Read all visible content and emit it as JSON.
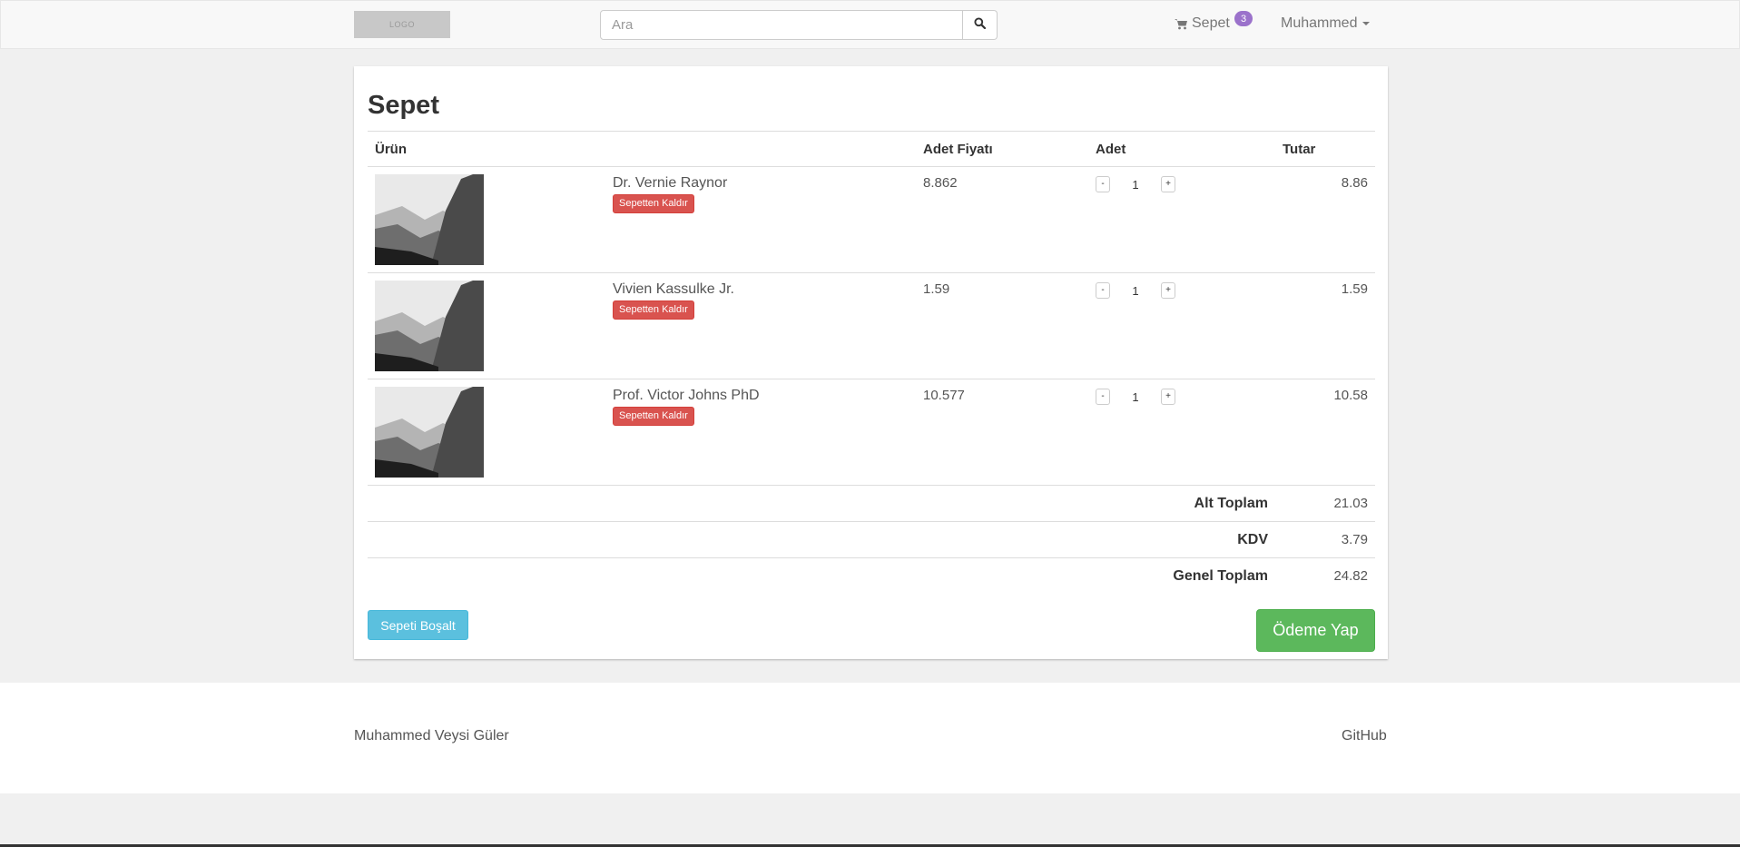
{
  "navbar": {
    "logo_text": "LOGO",
    "search_placeholder": "Ara",
    "search_icon": "search-icon",
    "cart_label": "Sepet",
    "cart_count": "3",
    "cart_icon": "shopping-cart-icon",
    "user_name": "Muhammed"
  },
  "cart": {
    "title": "Sepet",
    "headers": {
      "product": "Ürün",
      "unit_price": "Adet Fiyatı",
      "quantity": "Adet",
      "amount": "Tutar"
    },
    "items": [
      {
        "name": "Dr. Vernie Raynor",
        "remove_label": "Sepetten Kaldır",
        "unit_price": "8.862",
        "qty_minus": "-",
        "quantity": "1",
        "qty_plus": "+",
        "amount": "8.86"
      },
      {
        "name": "Vivien Kassulke Jr.",
        "remove_label": "Sepetten Kaldır",
        "unit_price": "1.59",
        "qty_minus": "-",
        "quantity": "1",
        "qty_plus": "+",
        "amount": "1.59"
      },
      {
        "name": "Prof. Victor Johns PhD",
        "remove_label": "Sepetten Kaldır",
        "unit_price": "10.577",
        "qty_minus": "-",
        "quantity": "1",
        "qty_plus": "+",
        "amount": "10.58"
      }
    ],
    "summary": {
      "subtotal_label": "Alt Toplam",
      "subtotal": "21.03",
      "tax_label": "KDV",
      "tax": "3.79",
      "total_label": "Genel Toplam",
      "total": "24.82"
    },
    "empty_button": "Sepeti Boşalt",
    "pay_button": "Ödeme Yap"
  },
  "footer": {
    "author": "Muhammed Veysi Güler",
    "github": "GitHub"
  }
}
